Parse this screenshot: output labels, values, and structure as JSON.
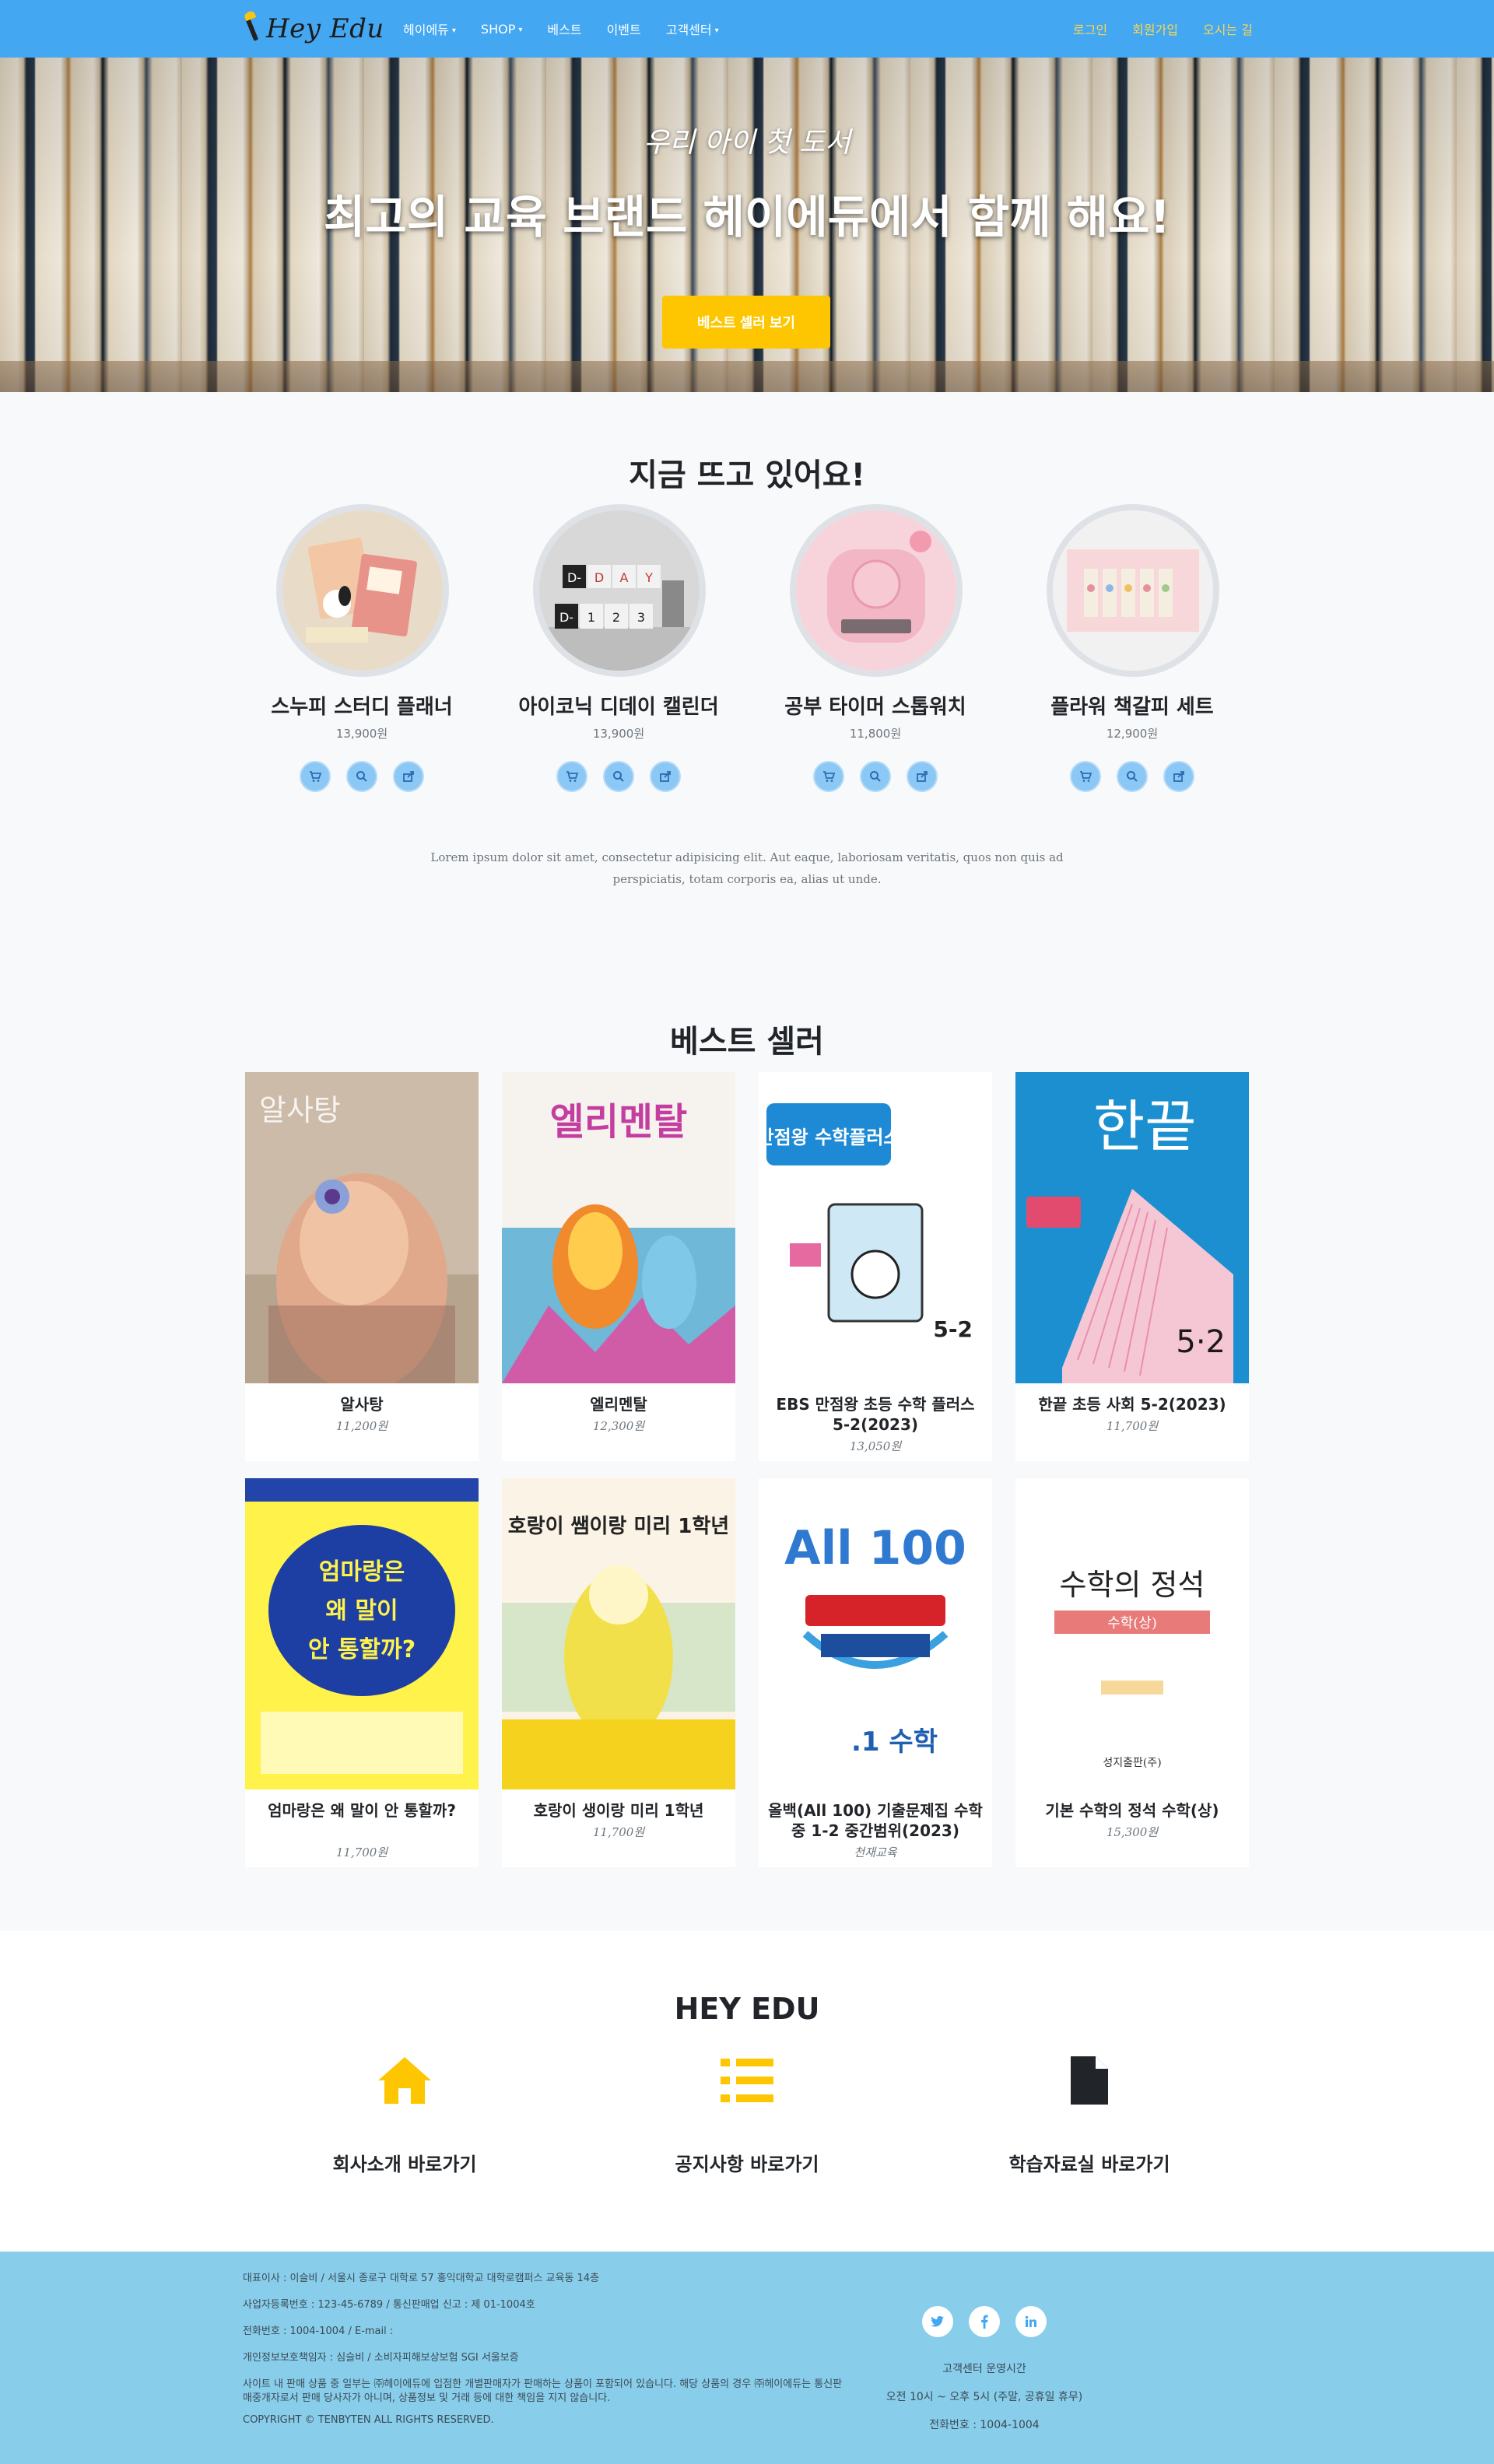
{
  "nav": {
    "brand": "Hey Edu",
    "menu": [
      "헤이에듀",
      "SHOP",
      "베스트",
      "이벤트",
      "고객센터"
    ],
    "right": [
      "로그인",
      "회원가입",
      "오시는 길"
    ]
  },
  "hero": {
    "subtitle": "우리 아이 첫 도서",
    "title": "최고의 교육 브랜드 헤이에듀에서 함께 해요!",
    "button": "베스트 셀러 보기"
  },
  "trending": {
    "title": "지금 뜨고 있어요!",
    "items": [
      {
        "name": "스누피 스터디 플래너",
        "price": "13,900원"
      },
      {
        "name": "아이코닉 디데이 캘린더",
        "price": "13,900원"
      },
      {
        "name": "공부 타이머 스톱워치",
        "price": "11,800원"
      },
      {
        "name": "플라워 책갈피 세트",
        "price": "12,900원"
      }
    ],
    "description": "Lorem ipsum dolor sit amet, consectetur adipisicing elit. Aut eaque, laboriosam veritatis, quos non quis ad perspiciatis, totam corporis ea, alias ut unde.",
    "calendar_text": [
      "D-",
      "D",
      "A",
      "Y",
      "D-",
      "1",
      "2",
      "3"
    ]
  },
  "best": {
    "title": "베스트 셀러",
    "books": [
      {
        "title": "알사탕",
        "price": "11,200원",
        "cover_text": "알사탕"
      },
      {
        "title": "엘리멘탈",
        "price": "12,300원",
        "cover_text": "엘리멘탈"
      },
      {
        "title": "EBS 만점왕 초등 수학 플러스 5-2(2023)",
        "price": "13,050원",
        "cover_text": "만점왕 수학플러스"
      },
      {
        "title": "한끝 초등 사회 5-2(2023)",
        "price": "11,700원",
        "cover_text": "한끝"
      },
      {
        "title": "엄마랑은 왜 말이 안 통할까?",
        "price": "11,700원",
        "cover_text": "엄마랑은 왜 말이 안 통할까?"
      },
      {
        "title": "호랑이 생이랑 미리 1학년",
        "price": "11,700원",
        "cover_text": "호랑이 쌤이랑 미리 1학년"
      },
      {
        "title": "올백(All 100) 기출문제집 수학 중 1-2 중간범위(2023)",
        "price": "천재교육",
        "cover_text": "All 100"
      },
      {
        "title": "기본 수학의 정석 수학(상)",
        "price": "15,300원",
        "cover_text": "수학의 정석"
      }
    ]
  },
  "heyedu": {
    "title": "HEY EDU",
    "links": [
      "회사소개 바로가기",
      "공지사항 바로가기",
      "학습자료실 바로가기"
    ]
  },
  "footer": {
    "lines": [
      "대표이사 : 이슬비 / 서울시 종로구 대학로 57 홍익대학교 대학로캠퍼스 교육동 14층",
      "사업자등록번호 : 123-45-6789 / 통신판매업 신고 : 제 01-1004호",
      "전화번호 : 1004-1004 / E-mail :",
      "개인정보보호책임자 : 심슬비 / 소비자피해보상보험 SGI 서울보증",
      "사이트 내 판매 상품 중 일부는 ㈜헤이에듀에 입점한 개별판매자가 판매하는 상품이 포함되어 있습니다. 해당 상품의 경우 ㈜헤이에듀는 통신판매중개자로서 판매 당사자가 아니며, 상품정보 및 거래 등에 대한 책임을 지지 않습니다."
    ],
    "copyright": "COPYRIGHT © TENBYTEN ALL RIGHTS RESERVED.",
    "social": [
      "twitter-icon",
      "facebook-icon",
      "linkedin-icon"
    ],
    "cs_title": "고객센터 운영시간",
    "cs_hours": "오전 10시 ~ 오후 5시 (주말, 공휴일 휴무)",
    "cs_phone": "전화번호 : 1004-1004"
  },
  "colors": {
    "nav_bg": "#44a7f2",
    "accent_yellow": "#fdc600",
    "footer_bg": "#88cdea",
    "section_bg": "#f8f9fa"
  }
}
